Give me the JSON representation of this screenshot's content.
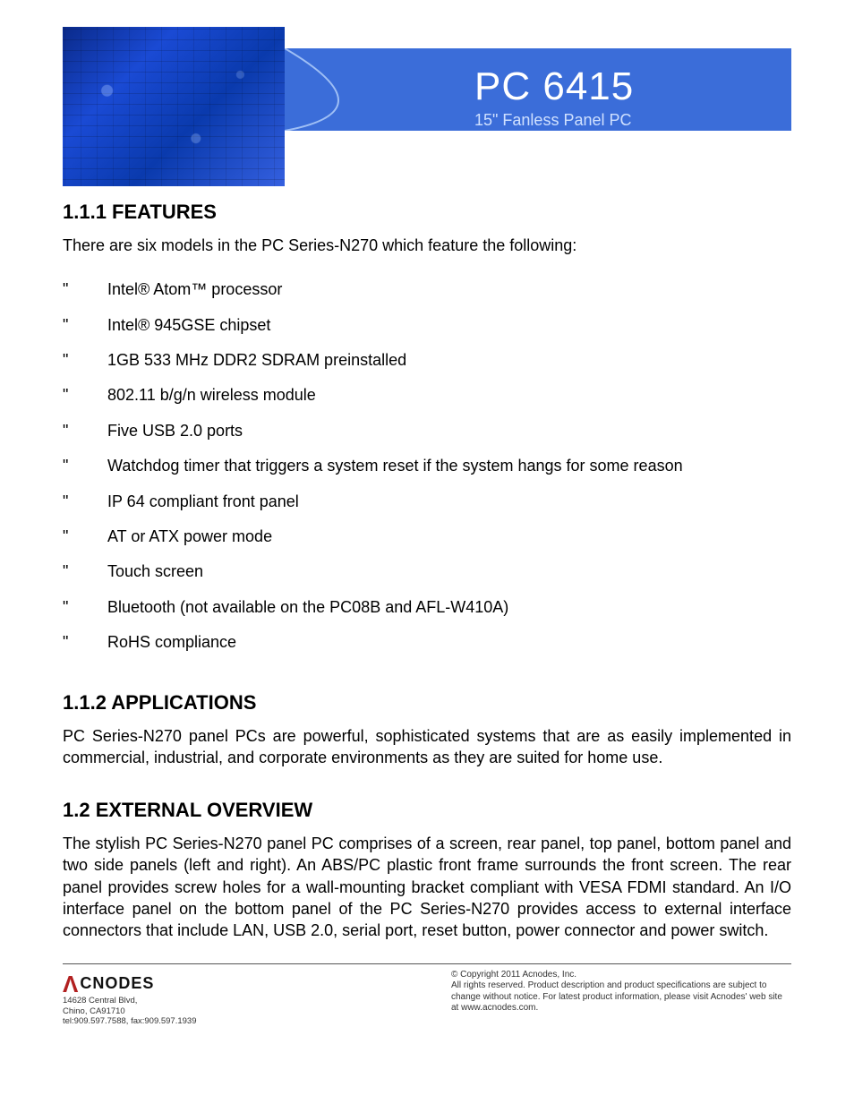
{
  "header": {
    "title": "PC 6415",
    "subtitle": "15\" Fanless Panel PC"
  },
  "sections": {
    "features": {
      "heading": "1.1.1 FEATURES",
      "intro": "There are six models in the PC Series-N270 which feature the following:",
      "items": [
        "Intel® Atom™ processor",
        "Intel® 945GSE chipset",
        "1GB 533 MHz DDR2 SDRAM preinstalled",
        "802.11 b/g/n wireless module",
        "Five USB 2.0 ports",
        "Watchdog timer that triggers a system reset if the system hangs for some reason",
        "IP 64 compliant front panel",
        "AT or ATX power mode",
        "Touch screen",
        "Bluetooth (not available on the PC08B and AFL-W410A)",
        "RoHS compliance"
      ]
    },
    "applications": {
      "heading": "1.1.2 APPLICATIONS",
      "body": "PC Series-N270 panel PCs are powerful, sophisticated systems that are as easily implemented in commercial, industrial, and corporate environments as they are suited for home use."
    },
    "external": {
      "heading": "1.2 EXTERNAL OVERVIEW",
      "body": "The stylish PC Series-N270 panel PC comprises of a screen, rear panel, top panel, bottom panel and two side panels (left and right). An ABS/PC plastic front frame surrounds the front screen. The rear panel provides screw holes for a wall-mounting bracket compliant with VESA FDMI standard. An I/O interface panel on the bottom panel of the PC Series-N270 provides access to external interface connectors that include LAN, USB 2.0, serial port, reset button, power connector and power switch."
    }
  },
  "footer": {
    "logo_text": "CNODES",
    "address_line1": "14628 Central Blvd,",
    "address_line2": "Chino, CA91710",
    "address_line3": "tel:909.597.7588, fax:909.597.1939",
    "copyright_line1": "© Copyright 2011 Acnodes, Inc.",
    "copyright_line2": "All rights reserved. Product description and product specifications are subject to change without notice. For latest product information, please visit Acnodes' web site at www.acnodes.com."
  }
}
